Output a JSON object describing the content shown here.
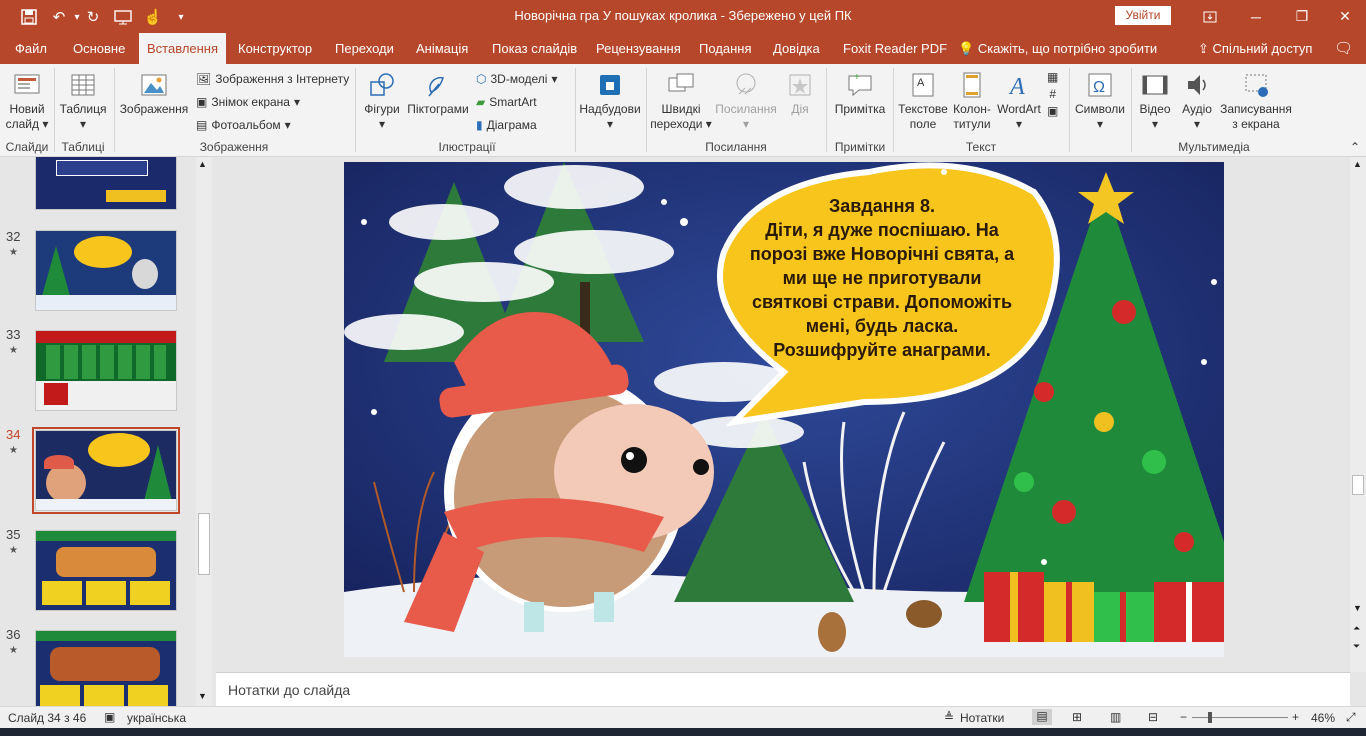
{
  "window": {
    "title": "Новорічна гра У пошуках кролика  -  Збережено у цей ПК",
    "signin_label": "Увійти"
  },
  "tabs": [
    {
      "label": "Файл"
    },
    {
      "label": "Основне"
    },
    {
      "label": "Вставлення"
    },
    {
      "label": "Конструктор"
    },
    {
      "label": "Переходи"
    },
    {
      "label": "Анімація"
    },
    {
      "label": "Показ слайдів"
    },
    {
      "label": "Рецензування"
    },
    {
      "label": "Подання"
    },
    {
      "label": "Довідка"
    },
    {
      "label": "Foxit Reader PDF"
    }
  ],
  "tell_me": "Скажіть, що потрібно зробити",
  "share": "Спільний доступ",
  "ribbon": {
    "new_slide": "Новий слайд",
    "table": "Таблиця",
    "images": "Зображення",
    "online_pictures": "Зображення з Інтернету",
    "screenshot": "Знімок екрана",
    "photo_album": "Фотоальбом",
    "shapes": "Фігури",
    "icons": "Піктограми",
    "models3d": "3D-моделі",
    "smartart": "SmartArt",
    "chart": "Діаграма",
    "addins": "Надбудови",
    "zoom": "Швидкі переходи",
    "link": "Посилання",
    "action": "Дія",
    "comment": "Примітка",
    "textbox": "Текстове поле",
    "header_footer": "Колон- титули",
    "wordart": "WordArt",
    "symbols": "Символи",
    "video": "Відео",
    "audio": "Аудіо",
    "screen_recording": "Записування з екрана",
    "groups": {
      "slides": "Слайди",
      "tables": "Таблиці",
      "images": "Зображення",
      "illustrations": "Ілюстрації",
      "links": "Посилання",
      "comments": "Примітки",
      "text": "Текст",
      "media": "Мультимедіа"
    }
  },
  "thumbnails": [
    {
      "num": "32"
    },
    {
      "num": "33"
    },
    {
      "num": "34"
    },
    {
      "num": "35"
    },
    {
      "num": "36"
    }
  ],
  "slide": {
    "task_lines": [
      "Завдання 8.",
      "Діти, я дуже поспішаю. На",
      "порозі  вже Новорічні свята, а",
      "ми ще не приготували",
      "святкові страви. Допоможіть",
      "мені, будь ласка.",
      "Розшифруйте анаграми."
    ]
  },
  "notes_placeholder": "Нотатки до слайда",
  "status": {
    "slide_counter": "Слайд 34 з 46",
    "language": "українська",
    "notes_button": "Нотатки",
    "zoom": "46%"
  },
  "colors": {
    "accent": "#b7472a",
    "ribbon_bg": "#f3f3f3",
    "slide_bg": "#1d2b63",
    "bubble": "#f8c51c"
  }
}
